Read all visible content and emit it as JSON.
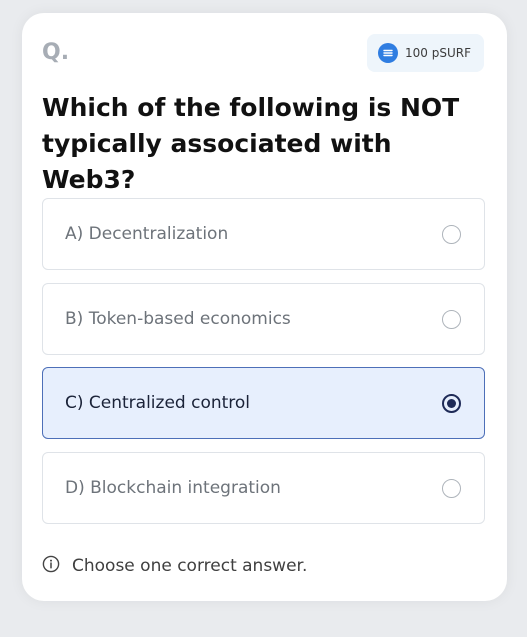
{
  "header": {
    "q_label": "Q.",
    "reward_label": "100 pSURF",
    "reward_icon": "coin-icon"
  },
  "question": {
    "text": "Which of the following is NOT typically associated with Web3?"
  },
  "options": [
    {
      "label": "A) Decentralization",
      "selected": false
    },
    {
      "label": "B) Token-based economics",
      "selected": false
    },
    {
      "label": "C) Centralized control",
      "selected": true
    },
    {
      "label": "D) Blockchain integration",
      "selected": false
    }
  ],
  "hint": {
    "icon": "info-icon",
    "text": "Choose one correct answer."
  },
  "colors": {
    "accent": "#2f7de1",
    "selected_bg": "#e7effd",
    "selected_border": "#4d6fb8",
    "selected_radio": "#1f2b58"
  }
}
